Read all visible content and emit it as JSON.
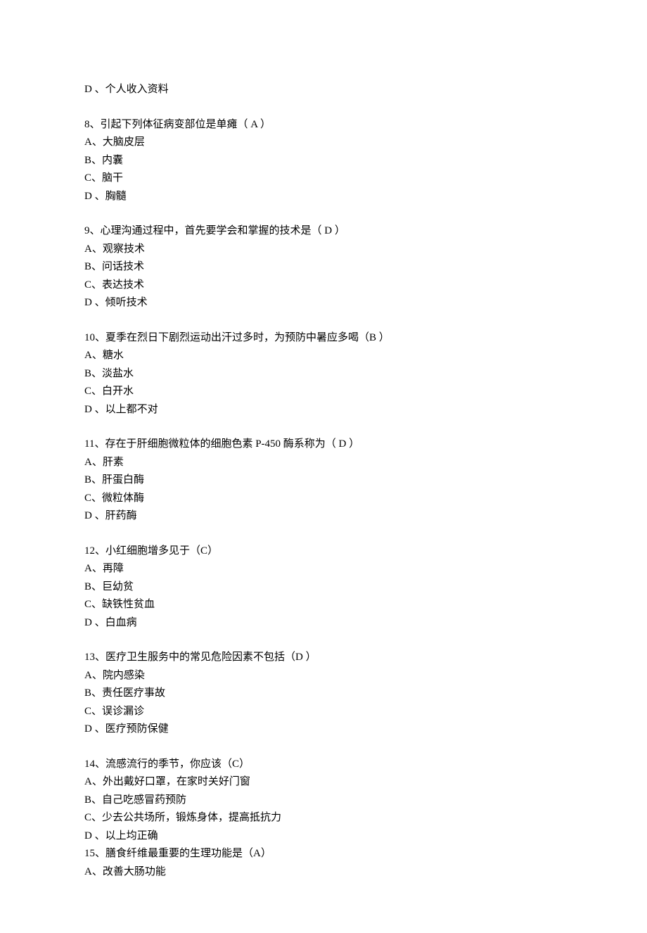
{
  "orphan_option": "D 、个人收入资料",
  "questions": [
    {
      "stem": "8、引起下列体征病变部位是单瘫（ A ）",
      "options": [
        "A、大脑皮层",
        "B、内囊",
        "C、脑干",
        "D 、胸髓"
      ]
    },
    {
      "stem": "9、心理沟通过程中，首先要学会和掌握的技术是（ D ）",
      "options": [
        "A、观察技术",
        "B、问话技术",
        "C、表达技术",
        "D 、倾听技术"
      ]
    },
    {
      "stem": "10、夏季在烈日下剧烈运动出汗过多时，为预防中暑应多喝（B ）",
      "options": [
        "A、糖水",
        "B、淡盐水",
        "C、白开水",
        "D 、以上都不对"
      ]
    },
    {
      "stem": "11、存在于肝细胞微粒体的细胞色素 P-450 酶系称为（ D ）",
      "options": [
        "A、肝素",
        "B、肝蛋白酶",
        "C、微粒体酶",
        "D 、肝药酶"
      ]
    },
    {
      "stem": "12、小红细胞增多见于（C）",
      "options": [
        "A、再障",
        "B、巨幼贫",
        "C、缺铁性贫血",
        "D 、白血病"
      ]
    },
    {
      "stem": "13、医疗卫生服务中的常见危险因素不包括（D ）",
      "options": [
        "A、院内感染",
        "B、责任医疗事故",
        "C、误诊漏诊",
        "D 、医疗预防保健"
      ]
    },
    {
      "stem": "14、流感流行的季节，你应该（C）",
      "options": [
        "A、外出戴好口罩，在家时关好门窗",
        "B、自己吃感冒药预防",
        "C、少去公共场所，锻炼身体，提高抵抗力",
        "D 、以上均正确"
      ]
    }
  ],
  "trailing_question": {
    "stem": "15、膳食纤维最重要的生理功能是（A）",
    "options": [
      "A、改善大肠功能"
    ]
  }
}
